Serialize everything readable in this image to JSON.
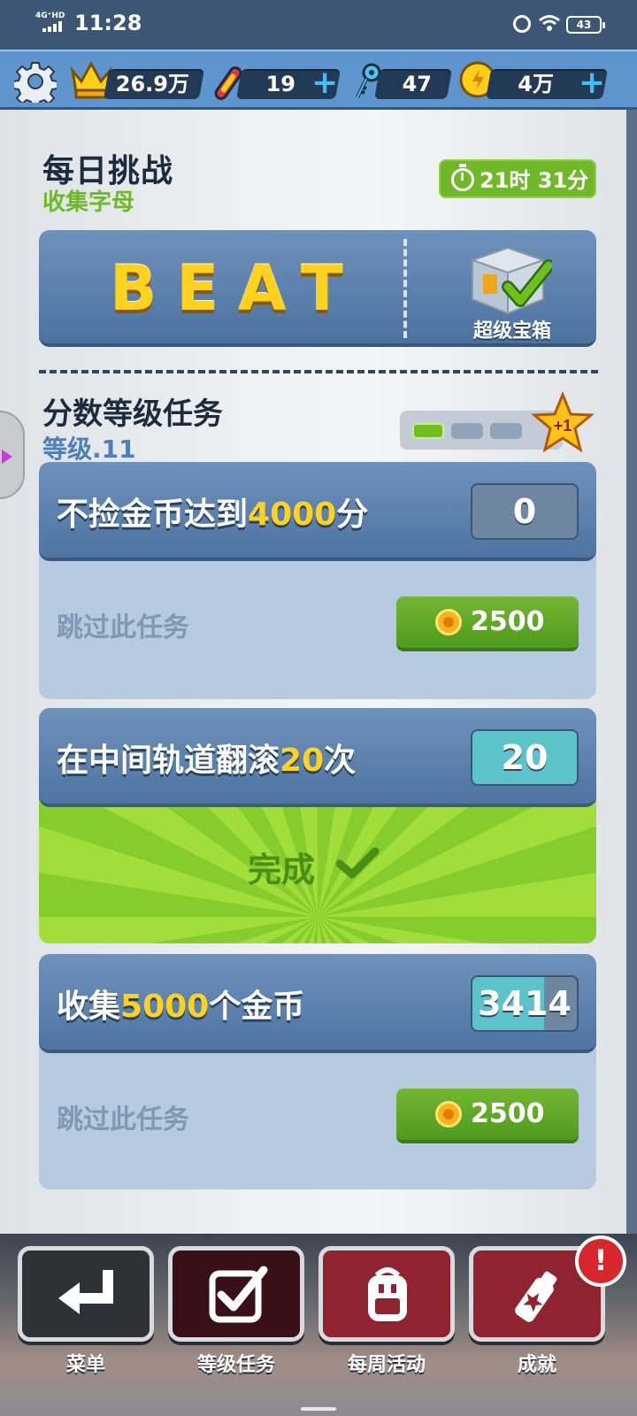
{
  "status_bar": {
    "network": "4G⁺HD",
    "time": "11:28",
    "battery": "43"
  },
  "currency_bar": {
    "score": "26.9万",
    "boards": "19",
    "keys": "47",
    "coins": "4万"
  },
  "daily_challenge": {
    "title": "每日挑战",
    "subtitle": "收集字母",
    "timer": "21时 31分",
    "word": "BEAT",
    "reward_label": "超级宝箱"
  },
  "missions": {
    "title": "分数等级任务",
    "level": "等级.11",
    "progress": {
      "completed": 1,
      "total": 3
    },
    "star_bonus": "+1",
    "tasks": [
      {
        "label_pre": "不捡金币达到",
        "label_hl": "4000",
        "label_post": "分",
        "value": "0",
        "progress": 0,
        "skip_text": "跳过此任务",
        "skip_cost": "2500"
      },
      {
        "label_pre": "在中间轨道翻滚",
        "label_hl": "20",
        "label_post": "次",
        "value": "20",
        "progress": 1,
        "done_text": "完成"
      },
      {
        "label_pre": "收集",
        "label_hl": "5000",
        "label_post": "个金币",
        "value": "3414",
        "progress": 0.6828,
        "skip_text": "跳过此任务",
        "skip_cost": "2500"
      }
    ]
  },
  "bottom_nav": {
    "items": [
      {
        "label": "菜单",
        "icon": "return-arrow-icon",
        "color": "#2f3136"
      },
      {
        "label": "等级任务",
        "icon": "checkbox-icon",
        "color": "#3a1018"
      },
      {
        "label": "每周活动",
        "icon": "backpack-icon",
        "color": "#8f2330"
      },
      {
        "label": "成就",
        "icon": "spray-can-icon",
        "color": "#8f2330"
      }
    ],
    "alert": "!"
  },
  "colors": {
    "accent_green": "#6fb82a",
    "highlight_yellow": "#ffd21f",
    "panel_blue": "#4f74a2"
  }
}
